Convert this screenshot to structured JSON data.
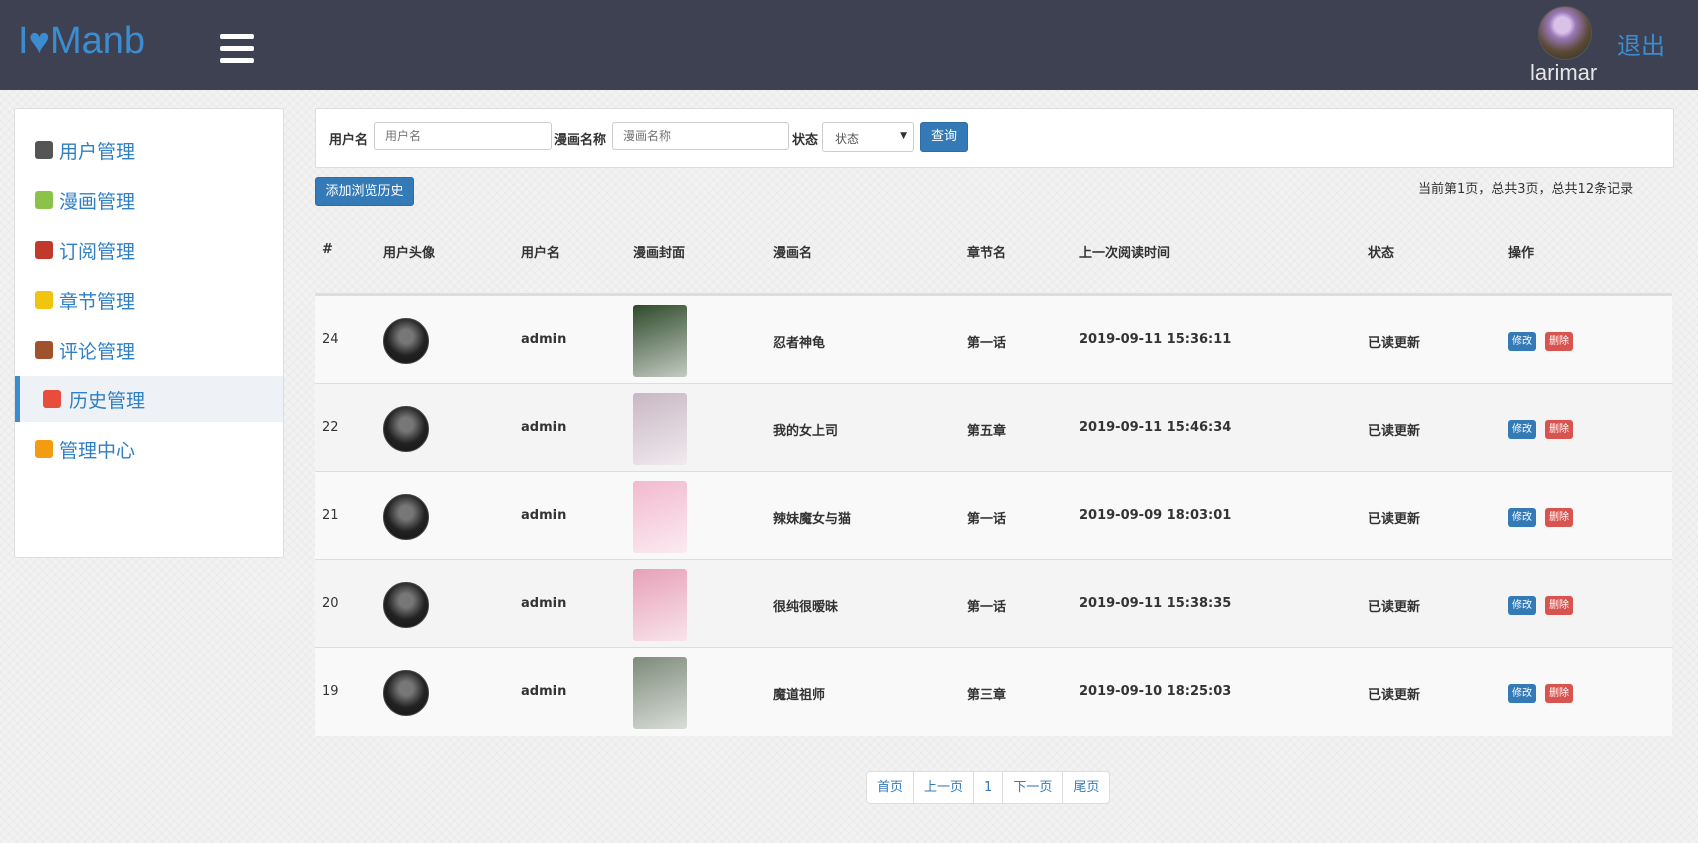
{
  "header": {
    "logo_prefix": "I",
    "logo_heart": "♥",
    "logo_suffix": "Manb",
    "username": "larimar",
    "logout_label": "退出"
  },
  "sidebar": {
    "items": [
      {
        "label": "用户管理",
        "icon": "user-icon",
        "color": "#555555"
      },
      {
        "label": "漫画管理",
        "icon": "books-icon",
        "color": "#8bc34a"
      },
      {
        "label": "订阅管理",
        "icon": "signpost-icon",
        "color": "#c0392b"
      },
      {
        "label": "章节管理",
        "icon": "star-icon",
        "color": "#f1c40f"
      },
      {
        "label": "评论管理",
        "icon": "clipboard-icon",
        "color": "#a0522d"
      },
      {
        "label": "历史管理",
        "icon": "calendar-icon",
        "color": "#e74c3c",
        "active": true
      },
      {
        "label": "管理中心",
        "icon": "home-icon",
        "color": "#f39c12"
      }
    ]
  },
  "search": {
    "username_label": "用户名",
    "username_placeholder": "用户名",
    "comic_label": "漫画名称",
    "comic_placeholder": "漫画名称",
    "status_label": "状态",
    "status_selected": "状态",
    "query_button": "查询"
  },
  "toolbar": {
    "add_button": "添加浏览历史",
    "record_info": "当前第1页，总共3页，总共12条记录"
  },
  "table": {
    "headers": [
      "#",
      "用户头像",
      "用户名",
      "漫画封面",
      "漫画名",
      "章节名",
      "上一次阅读时间",
      "状态",
      "操作"
    ],
    "edit_label": "修改",
    "delete_label": "删除",
    "rows": [
      {
        "id": "24",
        "user": "admin",
        "comic": "忍者神龟",
        "chapter": "第一话",
        "time": "2019-09-11 15:36:11",
        "status": "已读更新",
        "cover_color": "#2e4a2a"
      },
      {
        "id": "22",
        "user": "admin",
        "comic": "我的女上司",
        "chapter": "第五章",
        "time": "2019-09-11 15:46:34",
        "status": "已读更新",
        "cover_color": "#c9b7c4"
      },
      {
        "id": "21",
        "user": "admin",
        "comic": "辣妹魔女与猫",
        "chapter": "第一话",
        "time": "2019-09-09 18:03:01",
        "status": "已读更新",
        "cover_color": "#f2b9cf"
      },
      {
        "id": "20",
        "user": "admin",
        "comic": "很纯很暧昧",
        "chapter": "第一话",
        "time": "2019-09-11 15:38:35",
        "status": "已读更新",
        "cover_color": "#e7a0b8"
      },
      {
        "id": "19",
        "user": "admin",
        "comic": "魔道祖师",
        "chapter": "第三章",
        "time": "2019-09-10 18:25:03",
        "status": "已读更新",
        "cover_color": "#7d8b7a"
      }
    ]
  },
  "pagination": {
    "first": "首页",
    "prev": "上一页",
    "current": "1",
    "next": "下一页",
    "last": "尾页"
  }
}
